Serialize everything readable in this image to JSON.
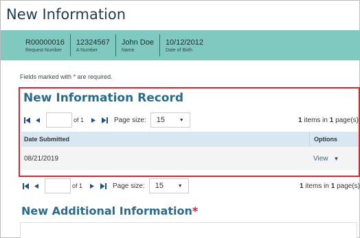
{
  "page": {
    "title": "New Information"
  },
  "info_bar": {
    "fields": [
      {
        "value": "R00000016",
        "label": "Request Number"
      },
      {
        "value": "12324567",
        "label": "A Number"
      },
      {
        "value": "John Doe",
        "label": "Name"
      },
      {
        "value": "10/12/2012",
        "label": "Date of Birth"
      }
    ]
  },
  "required_note": {
    "prefix": "Fields marked with ",
    "star": "*",
    "suffix": " are required."
  },
  "record_section": {
    "title": "New Information Record",
    "pager": {
      "page_value": "",
      "of_text": "of 1",
      "page_size_label": "Page size:",
      "page_size_value": "15",
      "items_count": "1",
      "items_mid": " items in ",
      "pages_count": "1",
      "items_suffix": " page(s)"
    },
    "columns": {
      "date": "Date Submitted",
      "options": "Options"
    },
    "rows": [
      {
        "date": "08/21/2019",
        "action": "View"
      }
    ]
  },
  "additional": {
    "title": "New Additional Information",
    "star": "*"
  },
  "colors": {
    "accent_bar": "#7fc9c0",
    "highlight_border": "#d8262f",
    "header_row": "#d9e7f3",
    "link": "#2a6a8a"
  }
}
